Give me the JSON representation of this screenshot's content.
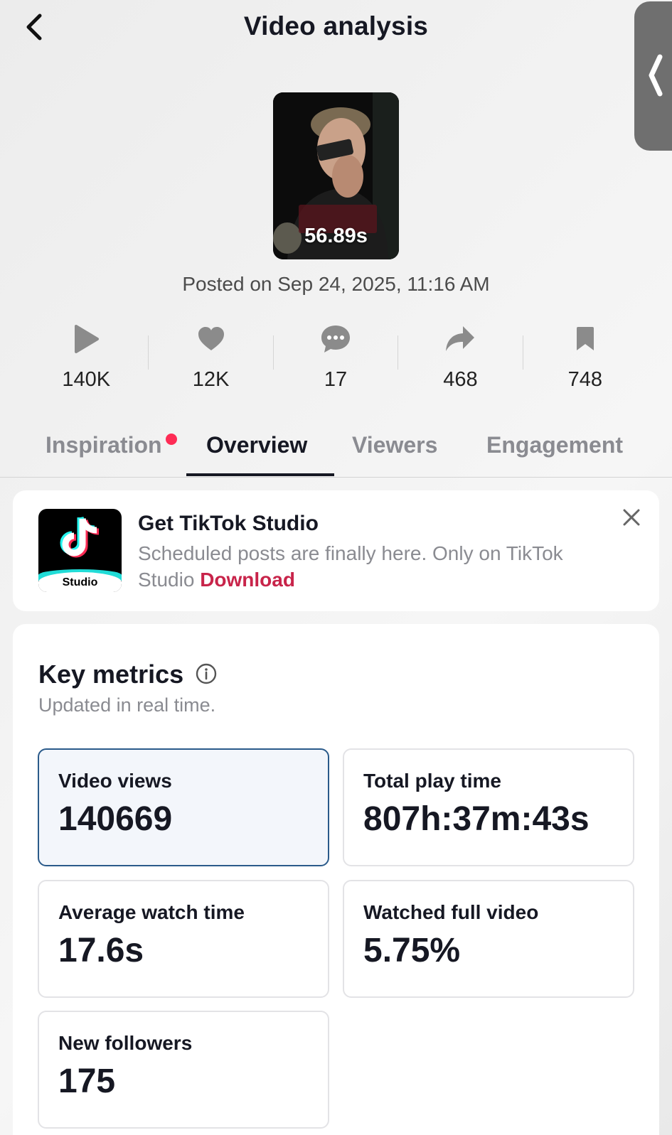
{
  "header": {
    "title": "Video analysis"
  },
  "video": {
    "duration": "56.89s",
    "posted": "Posted on Sep 24, 2025, 11:16 AM"
  },
  "stats": [
    {
      "icon": "play-icon",
      "value": "140K"
    },
    {
      "icon": "heart-icon",
      "value": "12K"
    },
    {
      "icon": "comment-icon",
      "value": "17"
    },
    {
      "icon": "share-icon",
      "value": "468"
    },
    {
      "icon": "bookmark-icon",
      "value": "748"
    }
  ],
  "tabs": [
    {
      "label": "Inspiration",
      "has_dot": true
    },
    {
      "label": "Overview",
      "active": true
    },
    {
      "label": "Viewers"
    },
    {
      "label": "Engagement"
    }
  ],
  "promo": {
    "title": "Get TikTok Studio",
    "description": "Scheduled posts are finally here. Only on TikTok Studio",
    "link": "Download",
    "logo_text": "Studio"
  },
  "key_metrics": {
    "title": "Key metrics",
    "subtitle": "Updated in real time.",
    "items": [
      {
        "label": "Video views",
        "value": "140669",
        "selected": true
      },
      {
        "label": "Total play time",
        "value": "807h:37m:43s"
      },
      {
        "label": "Average watch time",
        "value": "17.6s"
      },
      {
        "label": "Watched full video",
        "value": "5.75%"
      },
      {
        "label": "New followers",
        "value": "175"
      }
    ]
  },
  "colors": {
    "accent_red": "#fe2c55",
    "link": "#c8244a",
    "selected_border": "#2a5a8a",
    "muted_text": "#8a8b91"
  }
}
